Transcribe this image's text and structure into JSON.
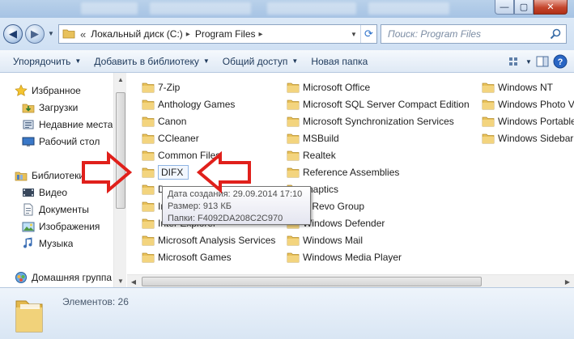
{
  "window": {
    "minimize_glyph": "—",
    "maximize_glyph": "▢",
    "close_glyph": "✕"
  },
  "address": {
    "root_chevron": "«",
    "crumbs": [
      "Локальный диск (C:)",
      "Program Files"
    ],
    "separator": "▸",
    "search_placeholder": "Поиск: Program Files"
  },
  "toolbar": {
    "organize": "Упорядочить",
    "add_to_library": "Добавить в библиотеку",
    "share": "Общий доступ",
    "new_folder": "Новая папка"
  },
  "nav": {
    "favorites": "Избранное",
    "downloads": "Загрузки",
    "recent": "Недавние места",
    "desktop": "Рабочий стол",
    "libraries": "Библиотеки",
    "video": "Видео",
    "documents": "Документы",
    "images": "Изображения",
    "music": "Музыка",
    "homegroup": "Домашняя группа"
  },
  "files": {
    "col1": [
      "7-Zip",
      "Anthology Games",
      "Canon",
      "CCleaner",
      "Common Files",
      "DIFX",
      "D",
      "In",
      "Inter Explorer",
      "Microsoft Analysis Services",
      "Microsoft Games"
    ],
    "col2": [
      "Microsoft Office",
      "Microsoft SQL Server Compact Edition",
      "Microsoft Synchronization Services",
      "MSBuild",
      "Realtek",
      "Reference Assemblies",
      "ynaptics",
      "S Revo Group",
      "Windows Defender",
      "Windows Mail",
      "Windows Media Player"
    ],
    "col3": [
      "Windows NT",
      "Windows Photo V",
      "Windows Portable",
      "Windows Sidebar"
    ]
  },
  "tooltip": {
    "created": "Дата создания: 29.09.2014 17:10",
    "size": "Размер: 913 КБ",
    "folders": "Папки: F4092DA208C2C970"
  },
  "status": {
    "items": "Элементов: 26"
  },
  "colors": {
    "folder": "#e8c15a",
    "arrow_red": "#e0201b",
    "link_blue": "#1e395b"
  }
}
